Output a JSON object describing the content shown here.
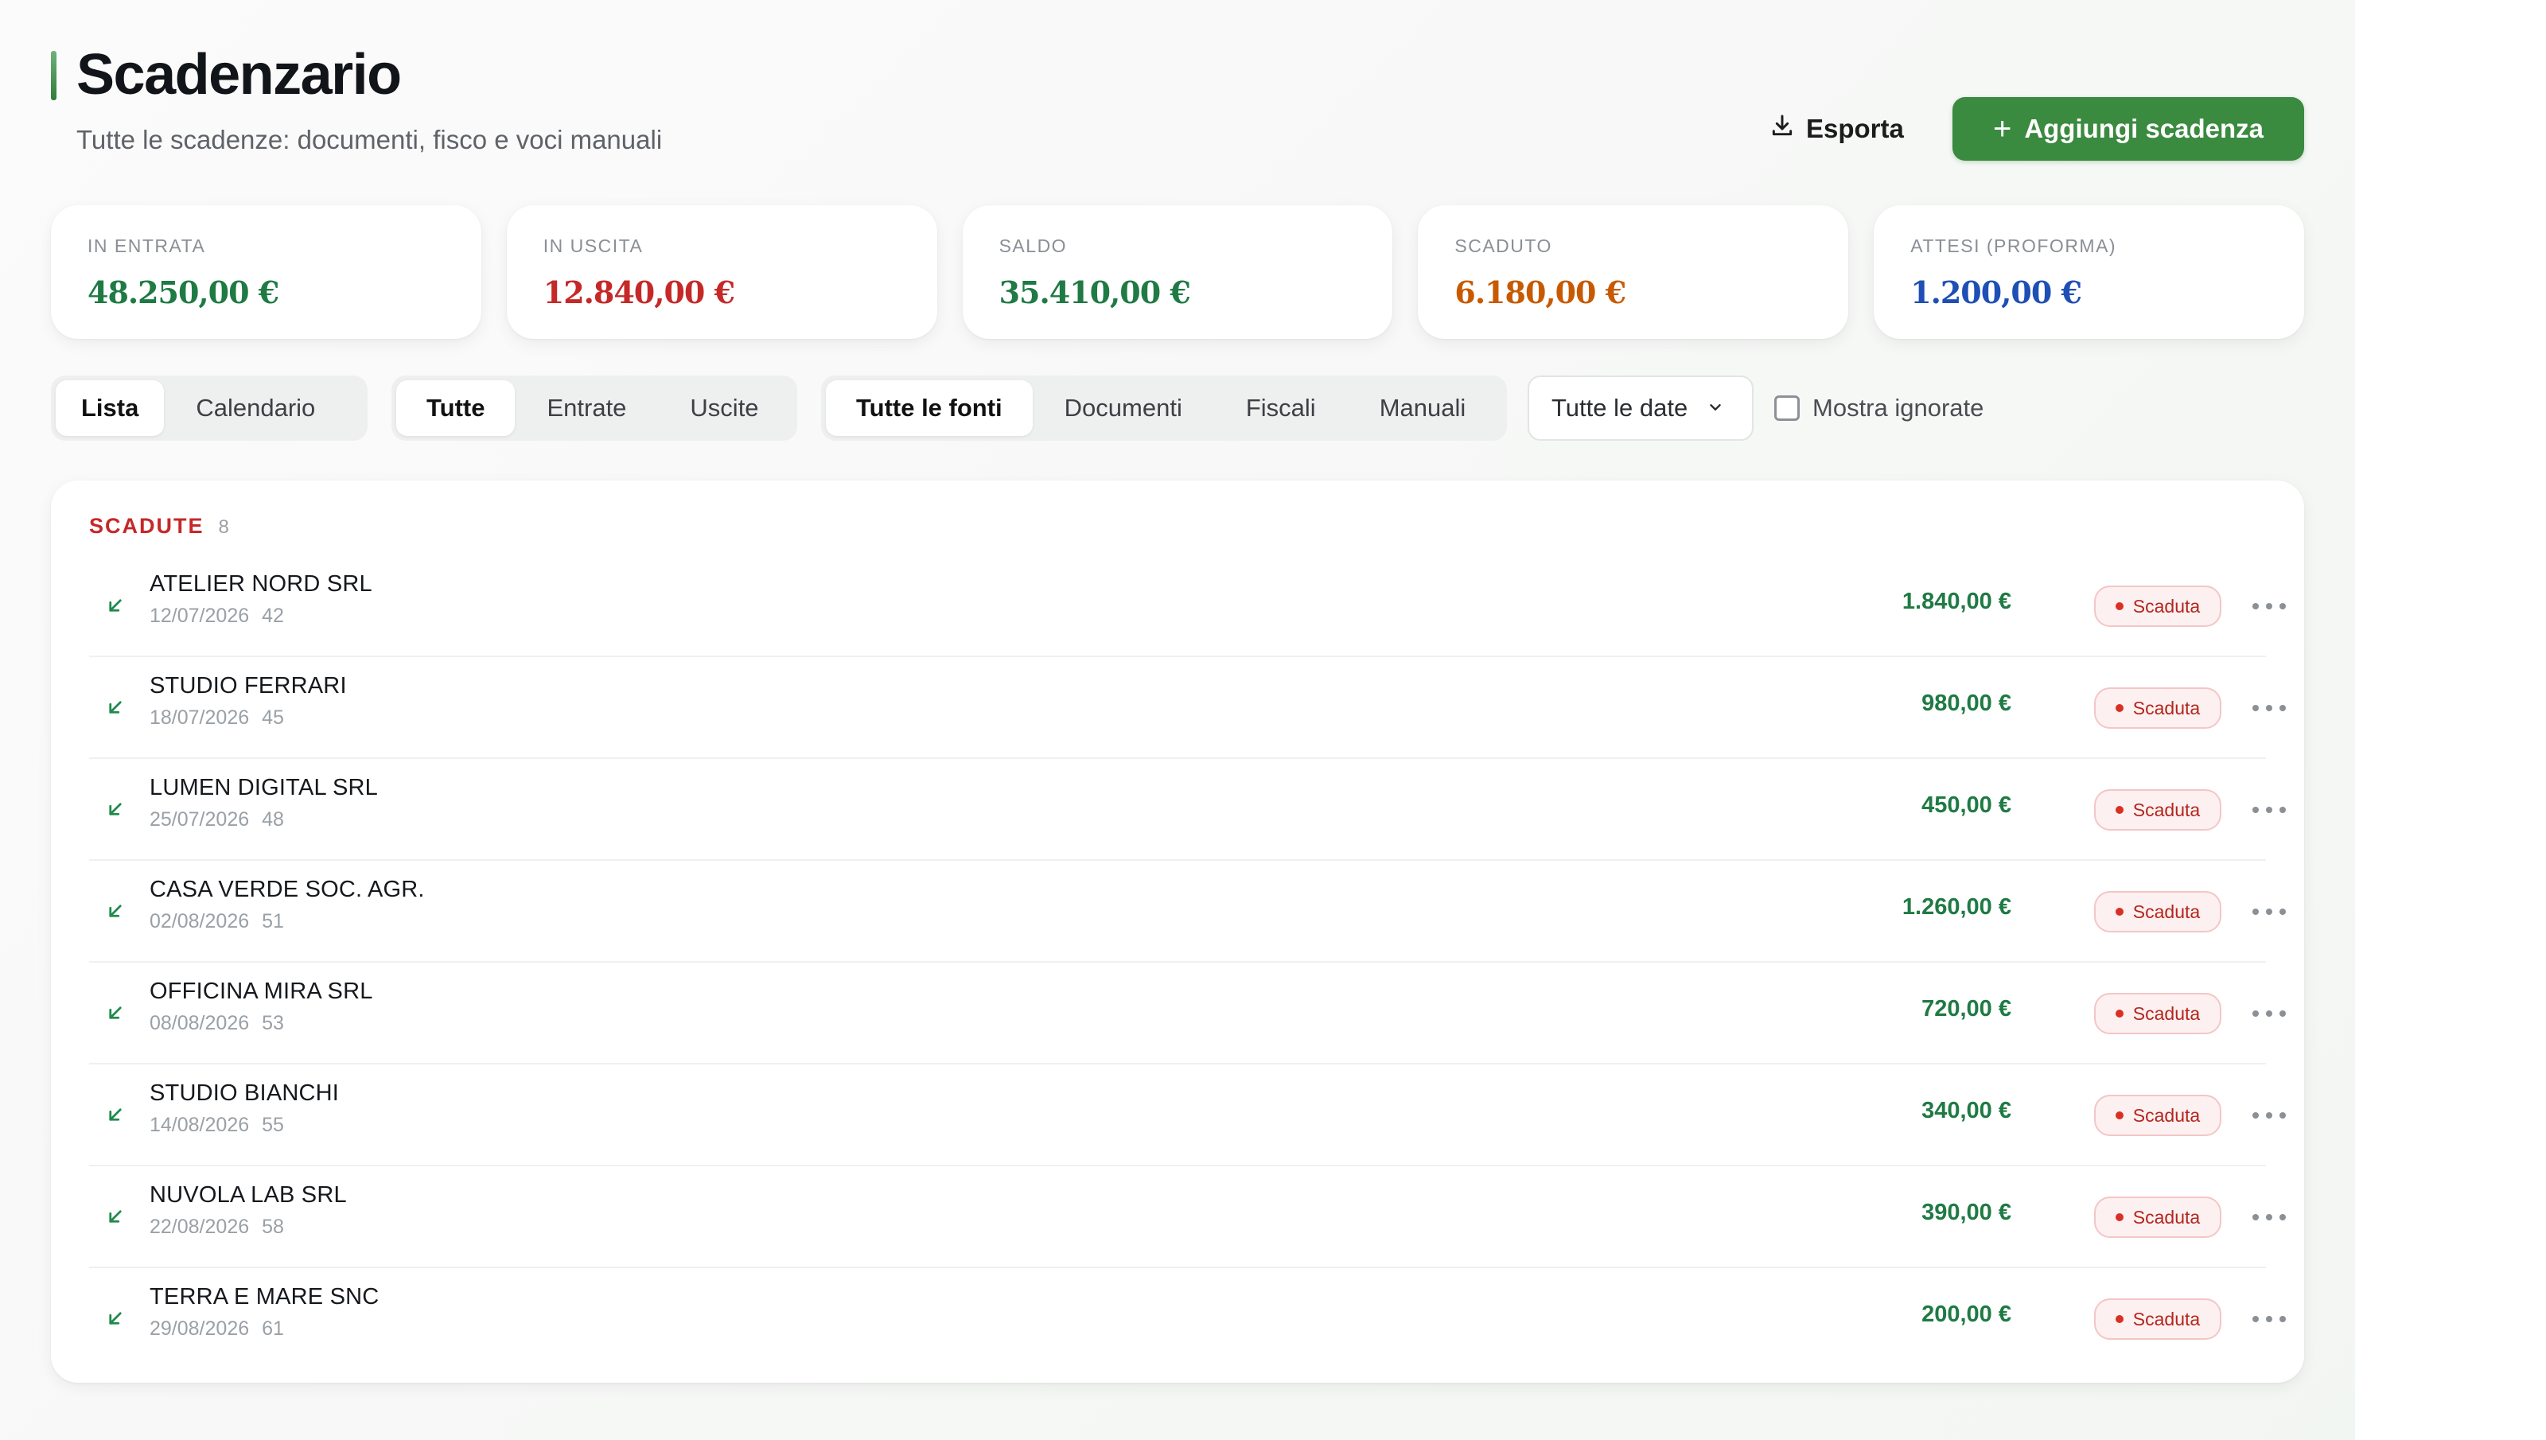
{
  "header": {
    "title": "Scadenzario",
    "subtitle": "Tutte le scadenze: documenti, fisco e voci manuali",
    "export_label": "Esporta",
    "add_label": "Aggiungi scadenza"
  },
  "stats": [
    {
      "label": "IN ENTRATA",
      "value": "48.250,00 €",
      "color": "#1f7a44"
    },
    {
      "label": "IN USCITA",
      "value": "12.840,00 €",
      "color": "#c62828"
    },
    {
      "label": "SALDO",
      "value": "35.410,00 €",
      "color": "#1f7a44"
    },
    {
      "label": "SCADUTO",
      "value": "6.180,00 €",
      "color": "#c75a00"
    },
    {
      "label": "ATTESI (PROFORMA)",
      "value": "1.200,00 €",
      "color": "#1f4fb5"
    }
  ],
  "filters": {
    "view": [
      "Lista",
      "Calendario"
    ],
    "direction": [
      "Tutte",
      "Entrate",
      "Uscite"
    ],
    "sources": [
      "Tutte le fonti",
      "Documenti",
      "Fiscali",
      "Manuali"
    ],
    "date_select": "Tutte le date",
    "show_ignored": "Mostra ignorate"
  },
  "section": {
    "title": "SCADUTE",
    "count": "8"
  },
  "rows": [
    {
      "name": "ATELIER NORD SRL",
      "date": "12/07/2026",
      "num": "42",
      "amount": "1.840,00 €",
      "status": "Scaduta"
    },
    {
      "name": "STUDIO FERRARI",
      "date": "18/07/2026",
      "num": "45",
      "amount": "980,00 €",
      "status": "Scaduta"
    },
    {
      "name": "LUMEN DIGITAL SRL",
      "date": "25/07/2026",
      "num": "48",
      "amount": "450,00 €",
      "status": "Scaduta"
    },
    {
      "name": "CASA VERDE SOC. AGR.",
      "date": "02/08/2026",
      "num": "51",
      "amount": "1.260,00 €",
      "status": "Scaduta"
    },
    {
      "name": "OFFICINA MIRA SRL",
      "date": "08/08/2026",
      "num": "53",
      "amount": "720,00 €",
      "status": "Scaduta"
    },
    {
      "name": "STUDIO BIANCHI",
      "date": "14/08/2026",
      "num": "55",
      "amount": "340,00 €",
      "status": "Scaduta"
    },
    {
      "name": "NUVOLA LAB SRL",
      "date": "22/08/2026",
      "num": "58",
      "amount": "390,00 €",
      "status": "Scaduta"
    },
    {
      "name": "TERRA E MARE SNC",
      "date": "29/08/2026",
      "num": "61",
      "amount": "200,00 €",
      "status": "Scaduta"
    }
  ]
}
